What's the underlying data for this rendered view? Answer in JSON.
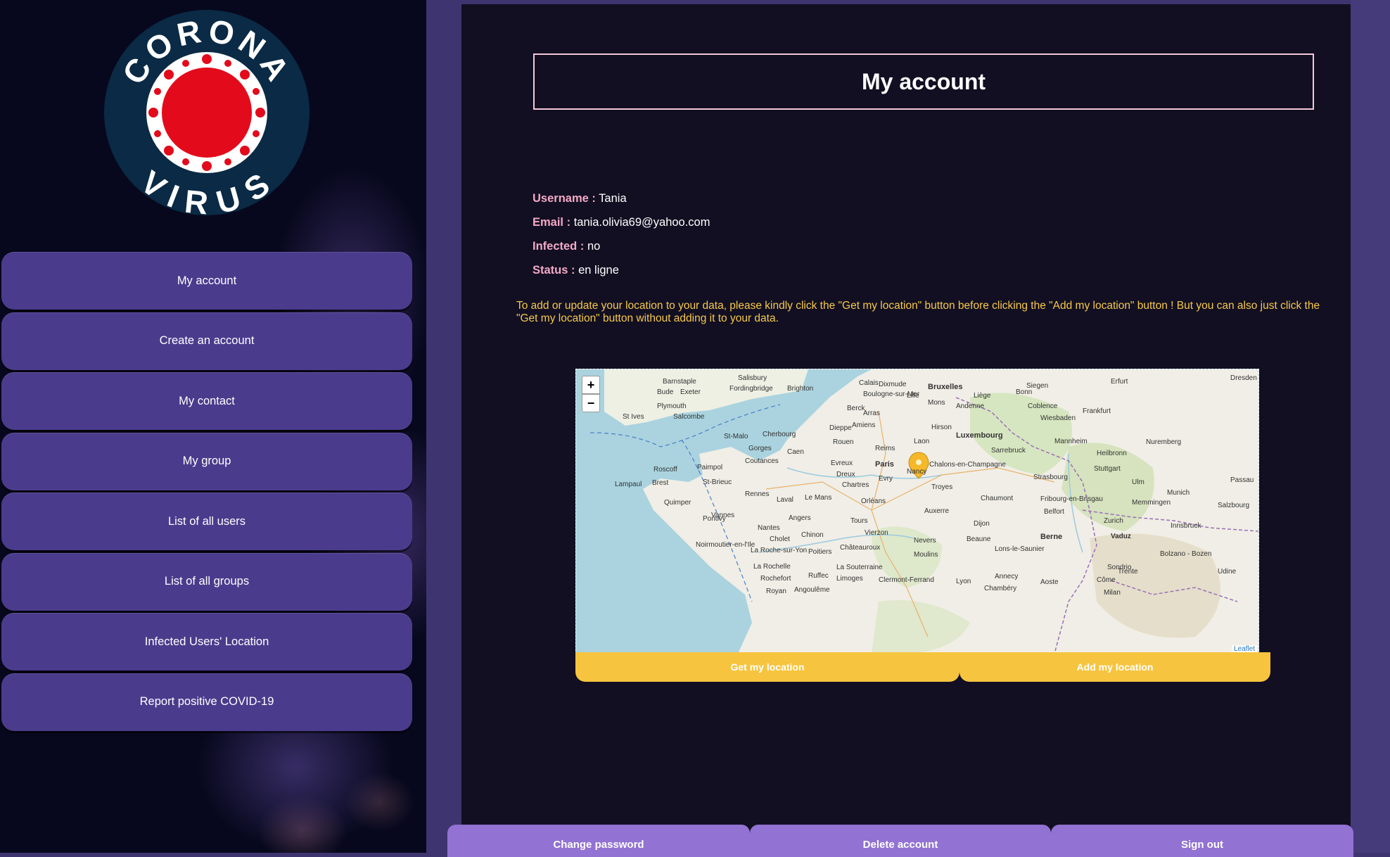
{
  "logo": {
    "top_text": "CORONA",
    "bottom_text": "VIRUS",
    "colors": {
      "ring": "#0a2a45",
      "core": "#e30b1b",
      "white": "#ffffff"
    }
  },
  "nav": {
    "items": [
      {
        "label": "My account"
      },
      {
        "label": "Create an account"
      },
      {
        "label": "My contact"
      },
      {
        "label": "My group"
      },
      {
        "label": "List of all users"
      },
      {
        "label": "List of all groups"
      },
      {
        "label": "Infected Users' Location"
      },
      {
        "label": "Report positive COVID-19"
      }
    ]
  },
  "page": {
    "title": "My account",
    "info": {
      "username_label": "Username :",
      "username": "Tania",
      "email_label": "Email :",
      "email": "tania.olivia69@yahoo.com",
      "infected_label": "Infected :",
      "infected": "no",
      "status_label": "Status :",
      "status": "en ligne"
    },
    "instructions": "To add or update your location to your data, please kindly click the \"Get my location\" button before clicking the \"Add my location\" button ! But you can also just click the \"Get my location\" button without adding it to your data."
  },
  "map": {
    "zoom_in": "+",
    "zoom_out": "−",
    "attribution": "Leaflet",
    "marker_icon": "map-pin-icon",
    "marker_color": "#f4b82a",
    "labels": [
      "Salisbury",
      "Brighton",
      "Calais",
      "Bruxelles",
      "Dixmude",
      "Lille",
      "Barnstaple",
      "Bude",
      "Exeter",
      "Fordingbridge",
      "Plymouth",
      "St Ives",
      "Salcombe",
      "Boulogne-sur-Mer",
      "Mons",
      "Liège",
      "Bonn",
      "Siegen",
      "Erfurt",
      "Dresden",
      "Arras",
      "Amiens",
      "Berck",
      "Andenne",
      "Coblence",
      "Wiesbaden",
      "Frankfurt",
      "Dieppe",
      "Hirson",
      "Luxembourg",
      "Mannheim",
      "Nuremberg",
      "Caen",
      "Rouen",
      "Reims",
      "Laon",
      "Sarrebruck",
      "Heilbronn",
      "Cherbourg",
      "St-Malo",
      "Gorges",
      "Coutances",
      "Paris",
      "Chalons-en-Champagne",
      "Nancy",
      "Strasbourg",
      "Stuttgart",
      "Munich",
      "Roscoff",
      "Paimpol",
      "Evreux",
      "Dreux",
      "Evry",
      "Troyes",
      "Ulm",
      "Passau",
      "Brest",
      "St-Brieuc",
      "Rennes",
      "Laval",
      "Le Mans",
      "Chartres",
      "Orléans",
      "Chaumont",
      "Fribourg-en-Brisgau",
      "Memmingen",
      "Salzbourg",
      "Lampaul",
      "Quimper",
      "Pontivy",
      "Vannes",
      "Angers",
      "Tours",
      "Auxerre",
      "Dijon",
      "Belfort",
      "Zurich",
      "Innsbruck",
      "Nantes",
      "Cholet",
      "Chinon",
      "Vierzon",
      "Nevers",
      "Beaune",
      "Berne",
      "Vaduz",
      "Bolzano - Bozen",
      "Noirmoutier-en-l'Ile",
      "La Roche-sur-Yon",
      "Poitiers",
      "Châteauroux",
      "Moulins",
      "Lons-le-Saunier",
      "Sondrio",
      "Trente",
      "Udine",
      "La Rochelle",
      "Rochefort",
      "Ruffec",
      "La Souterraine",
      "Limoges",
      "Clermont-Ferrand",
      "Lyon",
      "Chambéry",
      "Aoste",
      "Côme",
      "Royan",
      "Angoulême",
      "Annecy",
      "Milan"
    ]
  },
  "location_buttons": {
    "get": "Get my location",
    "add": "Add my location"
  },
  "bottom_buttons": {
    "change_password": "Change password",
    "delete_account": "Delete account",
    "sign_out": "Sign out"
  }
}
